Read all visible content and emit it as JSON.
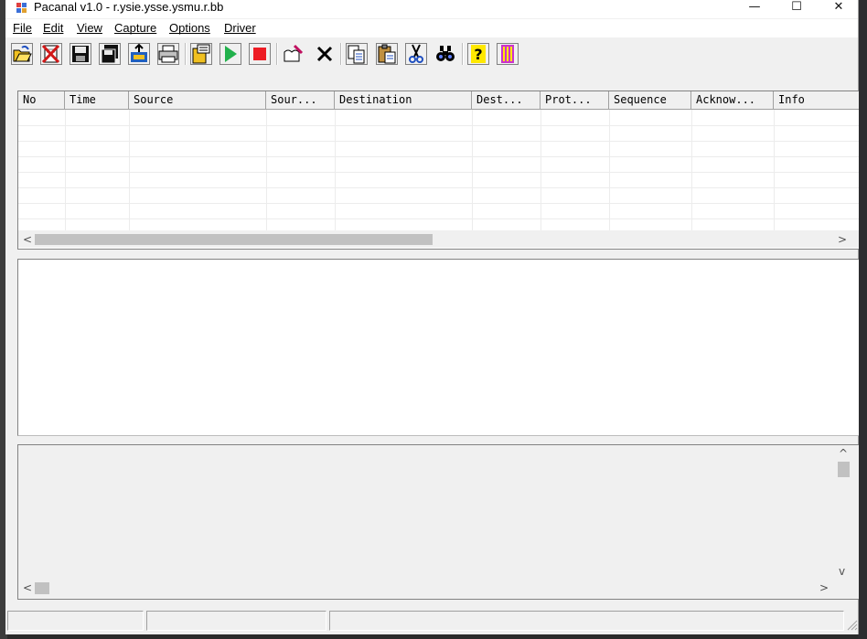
{
  "window": {
    "title": "Pacanal v1.0 - r.ysie.ysse.ysmu.r.bb",
    "minimize_glyph": "—",
    "maximize_glyph": "☐",
    "close_glyph": "✕"
  },
  "menu": {
    "items": [
      "File",
      "Edit",
      "View",
      "Capture",
      "Options",
      "Driver"
    ]
  },
  "toolbar": {
    "buttons": [
      "open-folder-icon",
      "delete-file-icon",
      "save-icon",
      "save-as-icon",
      "export-icon",
      "print-icon",
      "capture-settings-icon",
      "start-capture-icon",
      "stop-capture-icon",
      "filter-edit-icon",
      "clear-icon",
      "copy-icon",
      "paste-icon",
      "cut-icon",
      "find-icon",
      "help-icon",
      "about-icon"
    ]
  },
  "packet_list": {
    "columns": [
      "No",
      "Time",
      "Source",
      "Sour...",
      "Destination",
      "Dest...",
      "Prot...",
      "Sequence",
      "Acknow...",
      "Info"
    ],
    "rows": []
  },
  "scroll": {
    "left_arrow": "<",
    "right_arrow": ">",
    "up_arrow": "^",
    "down_arrow": "v"
  },
  "colors": {
    "start_green": "#22b14c",
    "stop_red": "#ed1c24",
    "help_yellow": "#ffe800",
    "about_magenta": "#cc33cc"
  }
}
